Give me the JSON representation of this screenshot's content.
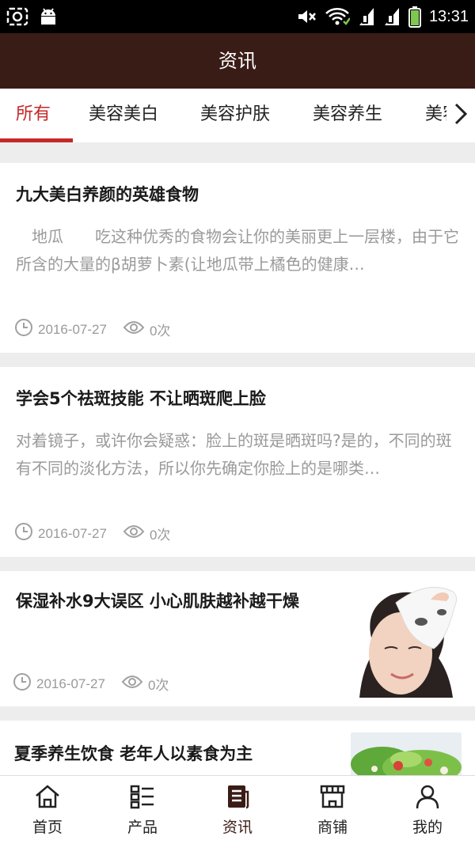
{
  "status_bar": {
    "time": "13:31"
  },
  "header": {
    "title": "资讯"
  },
  "tabs": [
    {
      "label": "所有",
      "active": true
    },
    {
      "label": "美容美白"
    },
    {
      "label": "美容护肤"
    },
    {
      "label": "美容养生"
    },
    {
      "label": "美容"
    }
  ],
  "articles": [
    {
      "title": "九大美白养颜的英雄食物",
      "summary": "　地瓜　　吃这种优秀的食物会让你的美丽更上一层楼，由于它所含的大量的β胡萝卜素(让地瓜带上橘色的健康…",
      "date": "2016-07-27",
      "views": "0次"
    },
    {
      "title": "学会5个祛斑技能 不让晒斑爬上脸",
      "summary": "对着镜子，或许你会疑惑：脸上的斑是晒斑吗?是的，不同的斑有不同的淡化方法，所以你先确定你脸上的是哪类…",
      "date": "2016-07-27",
      "views": "0次"
    },
    {
      "title": "保湿补水9大误区 小心肌肤越补越干燥",
      "date": "2016-07-27",
      "views": "0次",
      "thumb": "woman-with-face-mask"
    },
    {
      "title": "夏季养生饮食 老年人以素食为主",
      "thumb": "vegetable-salad"
    }
  ],
  "bottom_nav": [
    {
      "label": "首页",
      "icon": "home-icon"
    },
    {
      "label": "产品",
      "icon": "product-list-icon"
    },
    {
      "label": "资讯",
      "icon": "news-icon",
      "active": true
    },
    {
      "label": "商铺",
      "icon": "shop-icon"
    },
    {
      "label": "我的",
      "icon": "user-icon"
    }
  ],
  "colors": {
    "header_bg": "#3a1c17",
    "accent": "#c62828",
    "page_bg": "#ededed"
  }
}
